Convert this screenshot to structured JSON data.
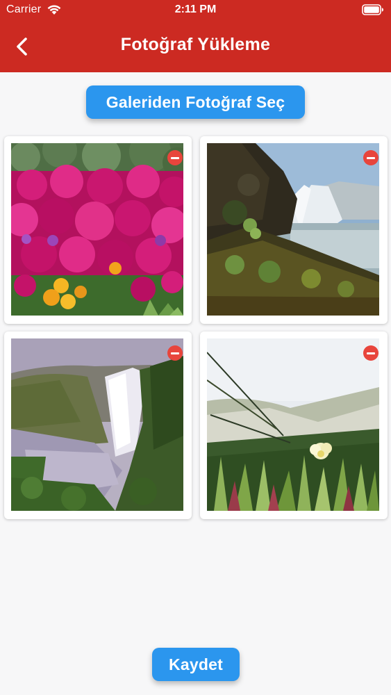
{
  "status_bar": {
    "carrier": "Carrier",
    "time": "2:11 PM",
    "wifi_icon": "wifi-icon",
    "battery_icon": "battery-icon"
  },
  "nav": {
    "title": "Fotoğraf Yükleme",
    "back_icon": "chevron-left-icon",
    "background_color": "#cc2a22"
  },
  "actions": {
    "pick_label": "Galeriden Fotoğraf Seç",
    "save_label": "Kaydet",
    "accent_color": "#2b96ee",
    "remove_icon": "minus-circle-icon",
    "remove_color": "#e8453c"
  },
  "photos": [
    {
      "subject": "pink flowers"
    },
    {
      "subject": "waterfall by rocky coast"
    },
    {
      "subject": "misty waterfall valley"
    },
    {
      "subject": "white flower in grass"
    }
  ]
}
